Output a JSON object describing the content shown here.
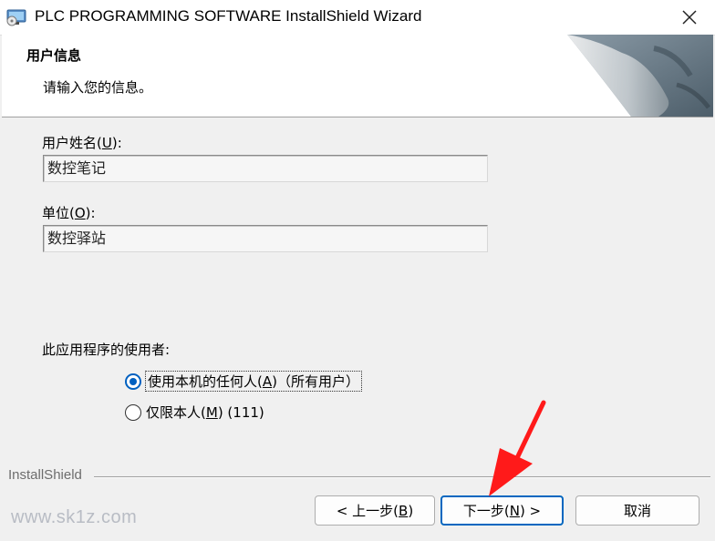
{
  "window": {
    "title": "PLC PROGRAMMING SOFTWARE InstallShield Wizard",
    "close_icon": "close-icon"
  },
  "header": {
    "title": "用户信息",
    "subtitle": "请输入您的信息。"
  },
  "form": {
    "username_label_pre": "用户姓名(",
    "username_label_key": "U",
    "username_label_post": "):",
    "username_value": "数控笔记",
    "org_label_pre": "单位(",
    "org_label_key": "O",
    "org_label_post": "):",
    "org_value": "数控驿站",
    "usage_label": "此应用程序的使用者:",
    "options": [
      {
        "pre": "使用本机的任何人(",
        "key": "A",
        "post": ")（所有用户）",
        "checked": true
      },
      {
        "pre": "仅限本人(",
        "key": "M",
        "post": ") (111)",
        "checked": false
      }
    ]
  },
  "footer": {
    "brand": "InstallShield",
    "back_pre": "< 上一步(",
    "back_key": "B",
    "back_post": ")",
    "next_pre": "下一步(",
    "next_key": "N",
    "next_post": ") >",
    "cancel": "取消"
  },
  "watermark": "www.sk1z.com",
  "colors": {
    "accent": "#0067c0",
    "arrow": "#ff1a1a"
  }
}
